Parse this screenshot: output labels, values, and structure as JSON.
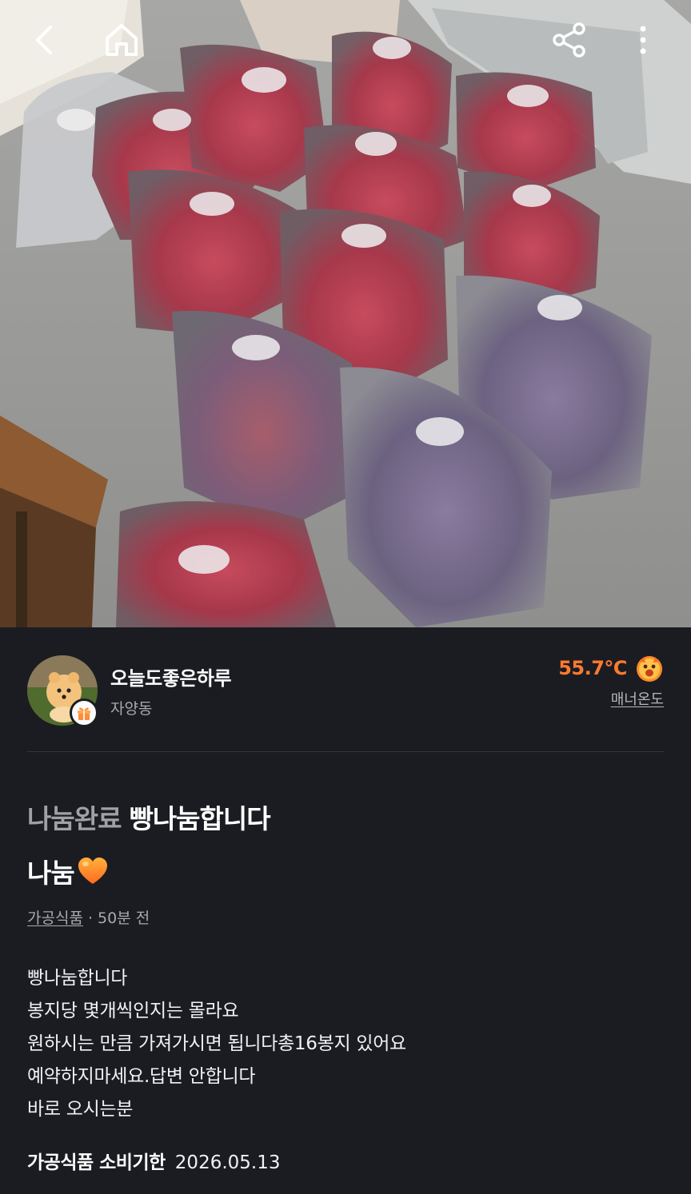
{
  "topbar": {
    "back_icon": "chevron-left-icon",
    "home_icon": "home-icon",
    "share_icon": "share-icon",
    "more_icon": "more-vertical-icon"
  },
  "profile": {
    "nickname": "오늘도좋은하루",
    "location": "자양동",
    "temperature": "55.7℃",
    "temperature_label": "매너온도",
    "temperature_color": "#ff7a2f"
  },
  "post": {
    "status": "나눔완료",
    "title": "빵나눔합니다",
    "subtitle": "나눔",
    "subtitle_icon": "orange-heart-icon",
    "category": "가공식품",
    "meta_separator": " · ",
    "time_ago": "50분 전",
    "body_lines": [
      "빵나눔합니다",
      "봉지당 몇개씩인지는 몰라요",
      "원하시는 만큼 가져가시면 됩니다총16봉지 있어요",
      "예약하지마세요.답변 안합니다",
      "바로 오시는분"
    ],
    "expiry_label": "가공식품 소비기한",
    "expiry_date": "2026.05.13"
  }
}
